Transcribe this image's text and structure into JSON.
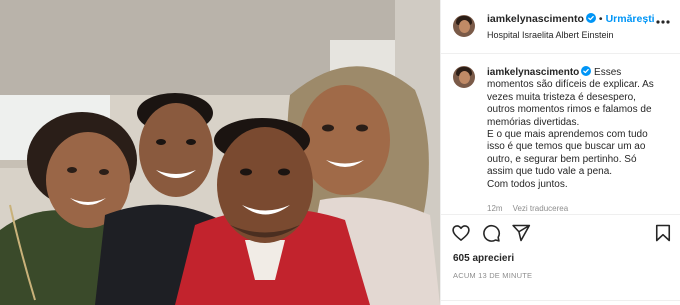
{
  "post": {
    "username": "iamkelynascimento",
    "follow_label": "Urmărești",
    "separator": "•",
    "location": "Hospital Israelita Albert Einstein",
    "caption_lines": [
      "Esses",
      "momentos são difíceis de explicar. As",
      "vezes muita tristeza é desespero,",
      "outros momentos rimos e falamos de",
      "memórias divertidas.",
      "E o que mais aprendemos com tudo",
      "isso é que temos que buscar um ao",
      "outro, e segurar bem pertinho. Só",
      "assim que tudo vale a pena.",
      "Com todos juntos."
    ],
    "caption_age": "12m",
    "translation_link": "Vezi traducerea",
    "likes": "605 aprecieri",
    "timestamp": "ACUM 13 DE MINUTE"
  },
  "icons": {
    "verified": "verified-badge-icon",
    "more": "more-options-icon",
    "like": "heart-icon",
    "comment": "comment-icon",
    "share": "share-icon",
    "save": "bookmark-icon"
  },
  "colors": {
    "accent": "#0095f6",
    "text": "#262626",
    "muted": "#8e8e8e",
    "border": "#efefef"
  }
}
